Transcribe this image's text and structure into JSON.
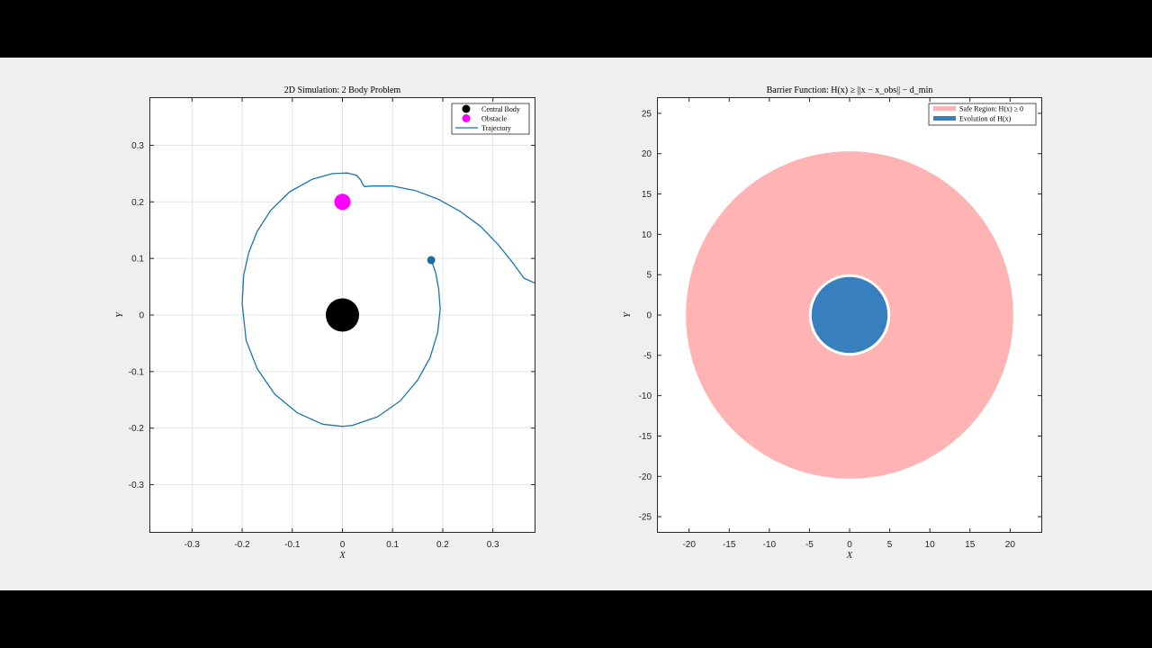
{
  "chart_data": [
    {
      "type": "line",
      "title": "2D Simulation: 2 Body Problem",
      "xlabel": "X",
      "ylabel": "Y",
      "xlim": [
        -0.385,
        0.385
      ],
      "ylim": [
        -0.385,
        0.385
      ],
      "xticks": [
        -0.3,
        -0.2,
        -0.1,
        0,
        0.1,
        0.2,
        0.3
      ],
      "yticks": [
        -0.3,
        -0.2,
        -0.1,
        0,
        0.1,
        0.2,
        0.3
      ],
      "xticklabels": [
        "-0.3",
        "-0.2",
        "-0.1",
        "0",
        "0.1",
        "0.2",
        "0.3"
      ],
      "yticklabels": [
        "-0.3",
        "-0.2",
        "-0.1",
        "0",
        "0.1",
        "0.2",
        "0.3"
      ],
      "grid": true,
      "legend": {
        "position": "top-right",
        "entries": [
          "Central Body",
          "Obstacle",
          "Trajectory"
        ]
      },
      "colors": {
        "central_body": "#000000",
        "obstacle": "#ff00ff",
        "trajectory": "#1a75a8",
        "current_position": "#1a6ea3"
      },
      "series": [
        {
          "name": "Central Body",
          "kind": "marker",
          "points": [
            [
              0,
              0
            ]
          ]
        },
        {
          "name": "Obstacle",
          "kind": "marker",
          "points": [
            [
              0,
              0.2
            ]
          ]
        },
        {
          "name": "Trajectory",
          "kind": "line",
          "points": [
            [
              0.177,
              0.097
            ],
            [
              0.186,
              0.075
            ],
            [
              0.192,
              0.045
            ],
            [
              0.195,
              0.01
            ],
            [
              0.19,
              -0.03
            ],
            [
              0.175,
              -0.075
            ],
            [
              0.15,
              -0.115
            ],
            [
              0.115,
              -0.152
            ],
            [
              0.07,
              -0.18
            ],
            [
              0.02,
              -0.195
            ],
            [
              0,
              -0.197
            ],
            [
              -0.04,
              -0.193
            ],
            [
              -0.09,
              -0.173
            ],
            [
              -0.135,
              -0.14
            ],
            [
              -0.17,
              -0.095
            ],
            [
              -0.192,
              -0.045
            ],
            [
              -0.2,
              0.02
            ],
            [
              -0.197,
              0.07
            ],
            [
              -0.187,
              0.11
            ],
            [
              -0.17,
              0.148
            ],
            [
              -0.143,
              0.185
            ],
            [
              -0.105,
              0.218
            ],
            [
              -0.06,
              0.24
            ],
            [
              -0.02,
              0.25
            ],
            [
              0.01,
              0.251
            ],
            [
              0.028,
              0.247
            ],
            [
              0.036,
              0.239
            ],
            [
              0.04,
              0.232
            ],
            [
              0.044,
              0.227
            ],
            [
              0.06,
              0.228
            ],
            [
              0.1,
              0.228
            ],
            [
              0.145,
              0.22
            ],
            [
              0.19,
              0.205
            ],
            [
              0.235,
              0.183
            ],
            [
              0.275,
              0.157
            ],
            [
              0.31,
              0.125
            ],
            [
              0.34,
              0.092
            ],
            [
              0.362,
              0.065
            ],
            [
              0.385,
              0.056
            ]
          ]
        },
        {
          "name": "",
          "kind": "marker",
          "points": [
            [
              0.177,
              0.097
            ]
          ]
        }
      ]
    },
    {
      "type": "area",
      "title": "Barrier Function: H(x) ≥ ||x − x_obs|| − d_min",
      "xlabel": "X",
      "ylabel": "Y",
      "xlim": [
        -24,
        24
      ],
      "ylim": [
        -27,
        27
      ],
      "xticks": [
        -20,
        -15,
        -10,
        -5,
        0,
        5,
        10,
        15,
        20
      ],
      "yticks": [
        -25,
        -20,
        -15,
        -10,
        -5,
        0,
        5,
        10,
        15,
        20,
        25
      ],
      "xticklabels": [
        "-20",
        "-15",
        "-10",
        "-5",
        "0",
        "5",
        "10",
        "15",
        "20"
      ],
      "yticklabels": [
        "-25",
        "-20",
        "-15",
        "-10",
        "-5",
        "0",
        "5",
        "10",
        "15",
        "20",
        "25"
      ],
      "grid": false,
      "legend": {
        "position": "top-right",
        "entries": [
          "Safe Region: H(x) ≥ 0",
          "Evolution of H(x)"
        ]
      },
      "colors": {
        "safe_region": "#ffb3b3",
        "evolution": "#3880bd",
        "evolution_edge": "#ffffff"
      },
      "series": [
        {
          "name": "Safe Region: H(x) ≥ 0",
          "kind": "disk",
          "center": [
            0,
            0
          ],
          "radius": 20
        },
        {
          "name": "Evolution of H(x)",
          "kind": "disk",
          "center": [
            0,
            0
          ],
          "radius": 4.9
        }
      ]
    }
  ]
}
